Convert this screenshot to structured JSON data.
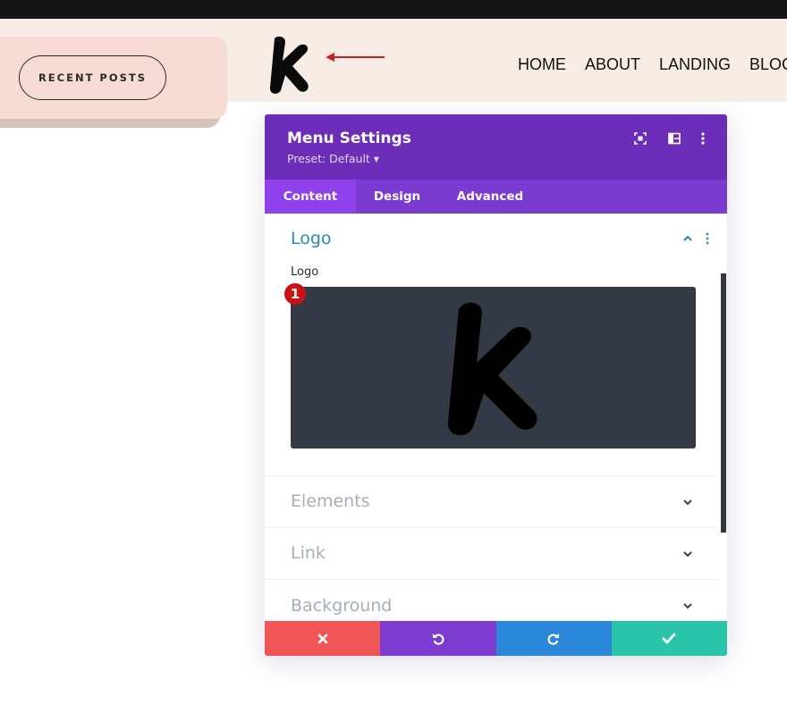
{
  "header": {
    "recent_posts_label": "RECENT POSTS",
    "nav": [
      "HOME",
      "ABOUT",
      "LANDING",
      "BLOG"
    ]
  },
  "panel": {
    "title": "Menu Settings",
    "preset": "Preset: Default ▾",
    "tabs": [
      "Content",
      "Design",
      "Advanced"
    ],
    "active_tab": "Content",
    "sections": {
      "logo": {
        "title": "Logo",
        "field_label": "Logo",
        "badge": "1"
      },
      "elements": "Elements",
      "link": "Link",
      "background": "Background"
    }
  },
  "icons": {
    "header": [
      "focus-icon",
      "split-view-icon",
      "more-vertical-icon"
    ],
    "footer": [
      "close-icon",
      "undo-icon",
      "redo-icon",
      "check-icon"
    ]
  },
  "colors": {
    "accent": "#6c2eb9",
    "tab_bar": "#7b3bd1",
    "tab_active": "#8f42ec",
    "cancel": "#ef5555",
    "undo": "#7e3bd0",
    "redo": "#2b87da",
    "save": "#29c4a9",
    "section_active": "#2b87b5",
    "arrow": "#d11d1d"
  }
}
